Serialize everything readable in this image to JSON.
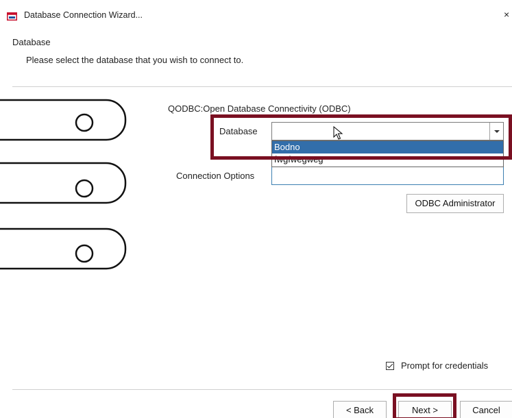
{
  "window": {
    "title": "Database Connection Wizard...",
    "close_glyph": "×"
  },
  "header": {
    "title": "Database",
    "subtitle": "Please select the database that you wish to connect to."
  },
  "form": {
    "odbc_label": "QODBC:Open Database Connectivity (ODBC)",
    "database_label": "Database",
    "database_value": "",
    "database_options": [
      "Bodno",
      "fwgfwegweg"
    ],
    "database_selected_option": "Bodno",
    "connection_options_label": "Connection Options",
    "connection_options_value": "",
    "odbc_admin_label": "ODBC Administrator",
    "prompt_credentials_label": "Prompt for credentials",
    "prompt_credentials_checked": true
  },
  "footer": {
    "back_label": "< Back",
    "next_label": "Next >",
    "cancel_label": "Cancel"
  },
  "icons": {
    "app": "database-wizard-icon",
    "graphic": "database-stack-illustration",
    "cursor": "mouse-pointer-icon"
  },
  "colors": {
    "highlight_border": "#7a1022",
    "selection_bg": "#326eaa",
    "input_focus_border": "#3c7fb1"
  }
}
